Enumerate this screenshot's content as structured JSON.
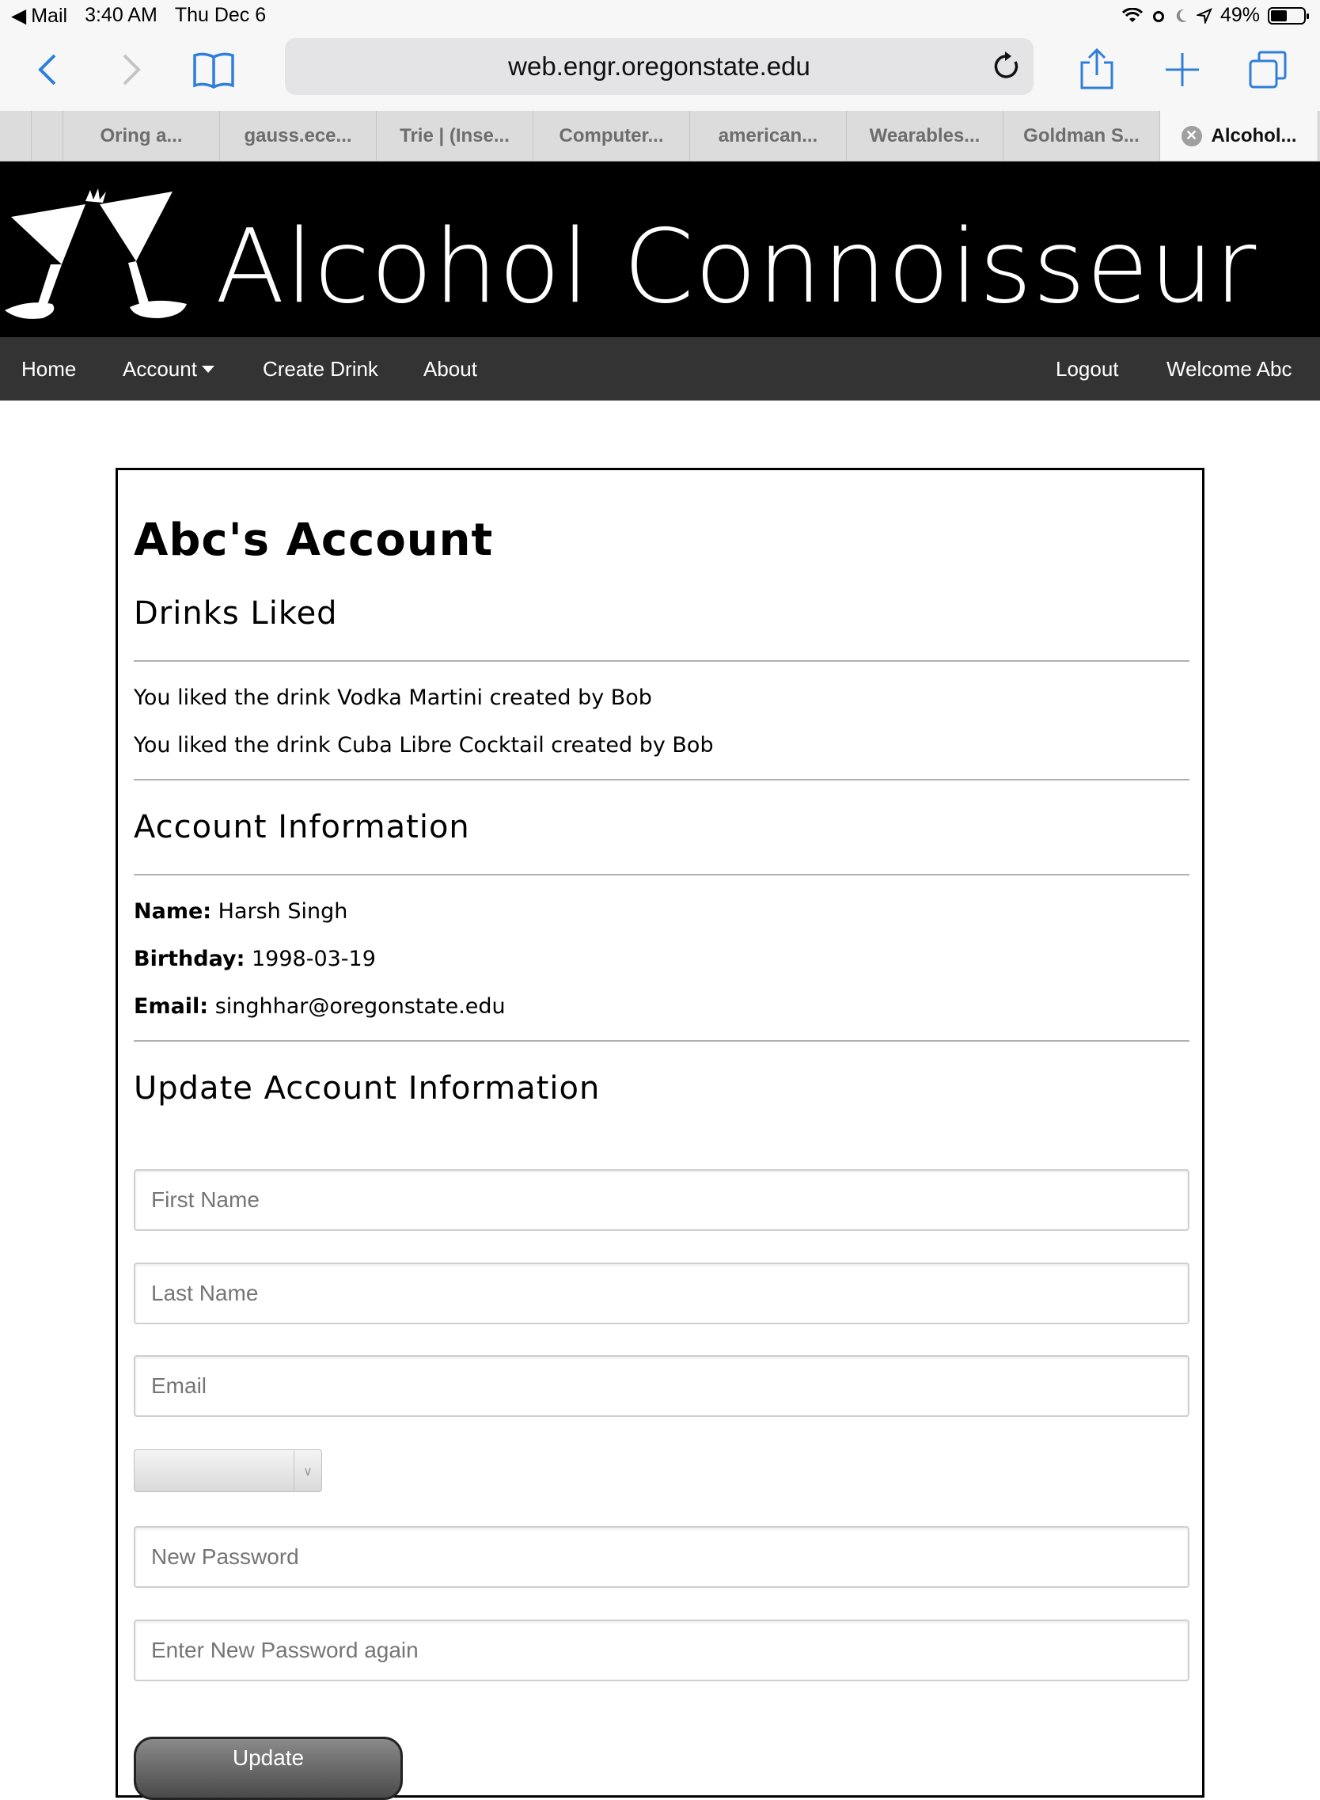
{
  "status_bar": {
    "back_app": "Mail",
    "time": "3:40 AM",
    "date": "Thu Dec 6",
    "battery_text": "49%",
    "battery_level": 0.49
  },
  "browser": {
    "url": "web.engr.oregonstate.edu",
    "tabs": [
      {
        "label": "Oring a..."
      },
      {
        "label": "gauss.ece..."
      },
      {
        "label": "Trie | (Inse..."
      },
      {
        "label": "Computer..."
      },
      {
        "label": "american..."
      },
      {
        "label": "Wearables..."
      },
      {
        "label": "Goldman S..."
      },
      {
        "label": "Alcohol...",
        "active": true
      }
    ],
    "accent_color": "#2f7fd9"
  },
  "site": {
    "title": "Alcohol Connoisseur",
    "nav": {
      "home": "Home",
      "account": "Account",
      "create_drink": "Create Drink",
      "about": "About",
      "logout": "Logout",
      "welcome": "Welcome Abc"
    }
  },
  "account": {
    "heading": "Abc's Account",
    "drinks_liked_heading": "Drinks Liked",
    "liked": [
      "You liked the drink Vodka Martini created by Bob",
      "You liked the drink Cuba Libre Cocktail created by Bob"
    ],
    "info_heading": "Account Information",
    "name_label": "Name:",
    "name_value": "Harsh Singh",
    "birthday_label": "Birthday:",
    "birthday_value": "1998-03-19",
    "email_label": "Email:",
    "email_value": "singhhar@oregonstate.edu",
    "update_heading": "Update Account Information",
    "form": {
      "first_name_placeholder": "First Name",
      "last_name_placeholder": "Last Name",
      "email_placeholder": "Email",
      "new_password_placeholder": "New Password",
      "confirm_password_placeholder": "Enter New Password again",
      "update_label": "Update"
    }
  }
}
